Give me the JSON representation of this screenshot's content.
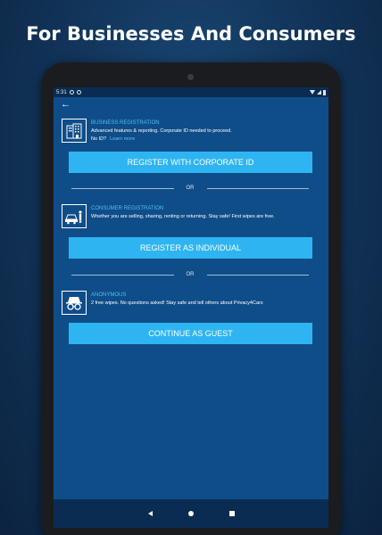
{
  "promo": {
    "heading": "For Businesses And Consumers"
  },
  "status_bar": {
    "time": "5:31"
  },
  "sections": {
    "business": {
      "title": "BUSINESS REGISTRATION",
      "description": "Advanced features & reporting. Corporate ID needed to proceed.",
      "no_id": "No ID?",
      "learn_more": "Learn more",
      "icon": "building-icon"
    },
    "consumer": {
      "title": "CONSUMER REGISTRATION",
      "description": "Whether you are selling, sharing, renting or returning. Stay safe! First wipes are free.",
      "icon": "car-person-icon"
    },
    "anonymous": {
      "title": "ANONYMOUS",
      "description": "2 free wipes. No questions asked! Stay safe and tell others about Privacy4Cars",
      "icon": "incognito-icon"
    }
  },
  "buttons": {
    "register_corporate": "REGISTER WITH CORPORATE ID",
    "register_individual": "REGISTER AS INDIVIDUAL",
    "continue_guest": "CONTINUE AS GUEST"
  },
  "divider_label": "OR",
  "colors": {
    "screen_bg": "#0f4d89",
    "accent": "#2eb5f1",
    "title_blue": "#4bc0f3"
  }
}
